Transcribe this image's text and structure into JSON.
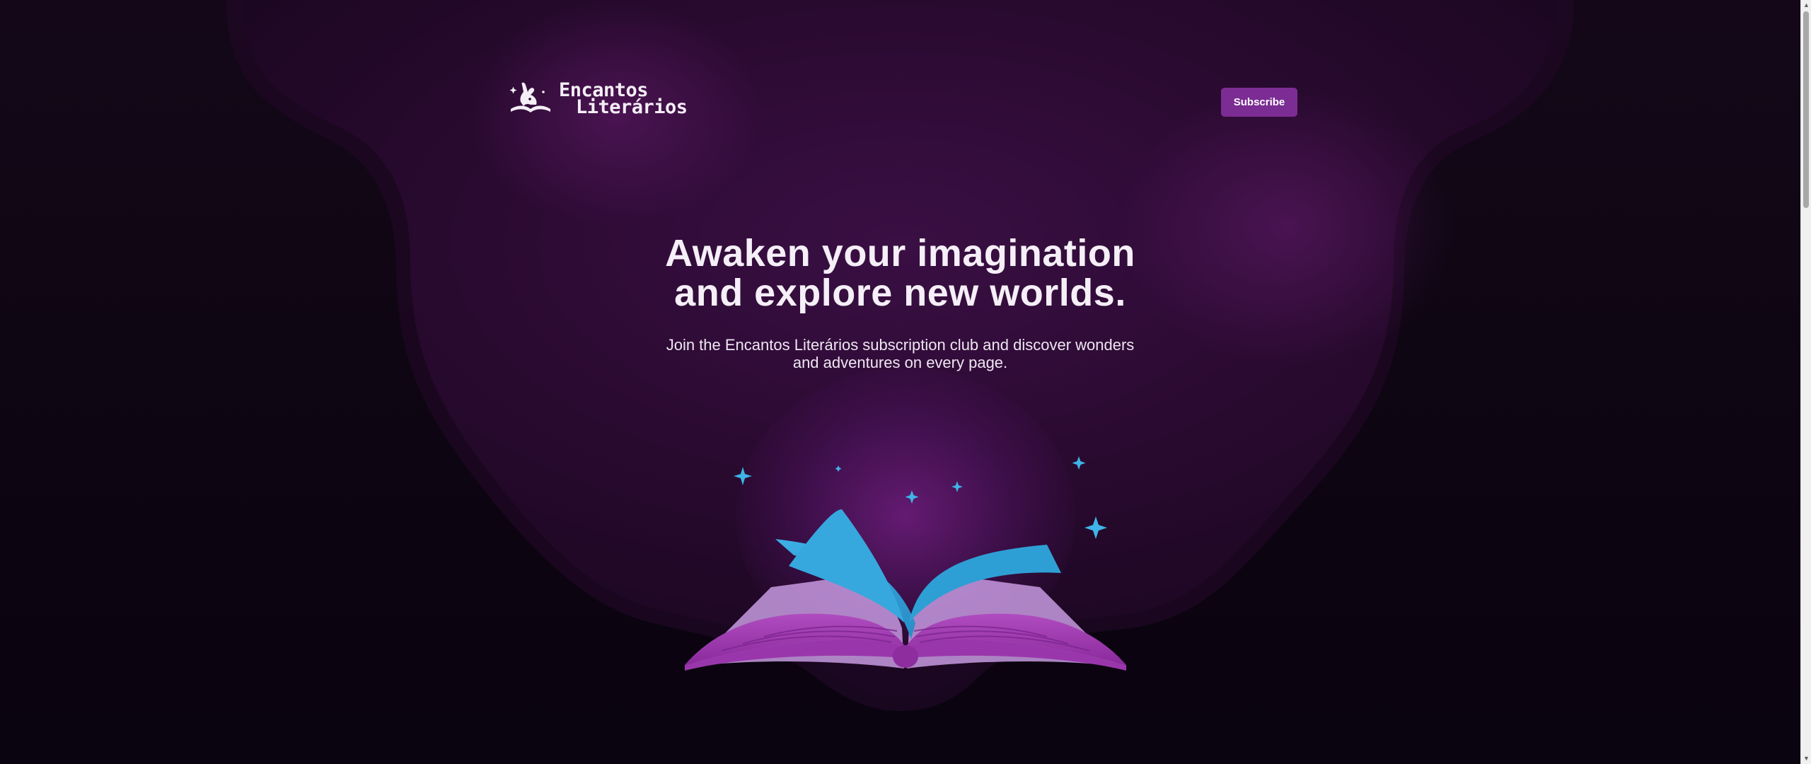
{
  "brand": {
    "name_line1": "Encantos",
    "name_line2": "Literários",
    "logo_icon": "reading-rabbit-icon"
  },
  "header": {
    "subscribe_label": "Subscribe"
  },
  "hero": {
    "title_line1": "Awaken your imagination",
    "title_line2": "and explore new worlds.",
    "subtitle": "Join the Encantos Literários subscription club and discover wonders and adventures on every page."
  },
  "illustration": {
    "icon": "open-book-icon",
    "sparkle_icon": "sparkle-icon"
  },
  "colors": {
    "background": "#0e0612",
    "blob": "#2a0c30",
    "accent": "#7b2d93",
    "page_blue": "#2e9fd4",
    "book_purple": "#a83fb4",
    "sparkle": "#3fb4e8",
    "text": "#f5eff7"
  }
}
